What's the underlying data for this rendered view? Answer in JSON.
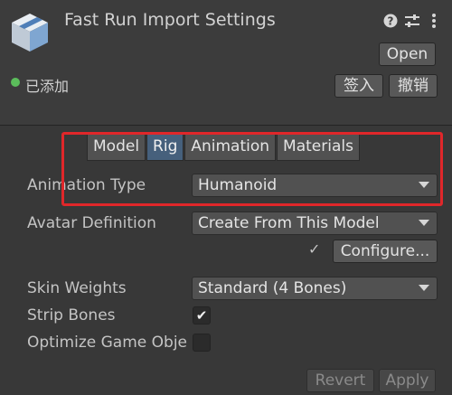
{
  "header": {
    "title": "Fast Run Import Settings",
    "open_label": "Open",
    "status": "已添加",
    "checkin_label": "签入",
    "revert_label": "撤销",
    "icons": [
      "help-icon",
      "preset-icon",
      "more-icon"
    ]
  },
  "tabs": [
    {
      "label": "Model",
      "active": false
    },
    {
      "label": "Rig",
      "active": true
    },
    {
      "label": "Animation",
      "active": false
    },
    {
      "label": "Materials",
      "active": false
    }
  ],
  "rig": {
    "animation_type_label": "Animation Type",
    "animation_type_value": "Humanoid",
    "avatar_definition_label": "Avatar Definition",
    "avatar_definition_value": "Create From This Model",
    "configure_label": "Configure...",
    "configure_check": "✓",
    "skin_weights_label": "Skin Weights",
    "skin_weights_value": "Standard (4 Bones)",
    "strip_bones_label": "Strip Bones",
    "strip_bones_checked": true,
    "strip_bones_mark": "✔",
    "optimize_label": "Optimize Game Obje",
    "optimize_checked": false
  },
  "footer": {
    "revert_label": "Revert",
    "apply_label": "Apply"
  },
  "colors": {
    "background": "#383838",
    "active_tab": "#46607c",
    "highlight": "#e0272a",
    "status_dot": "#5bbd5b"
  }
}
